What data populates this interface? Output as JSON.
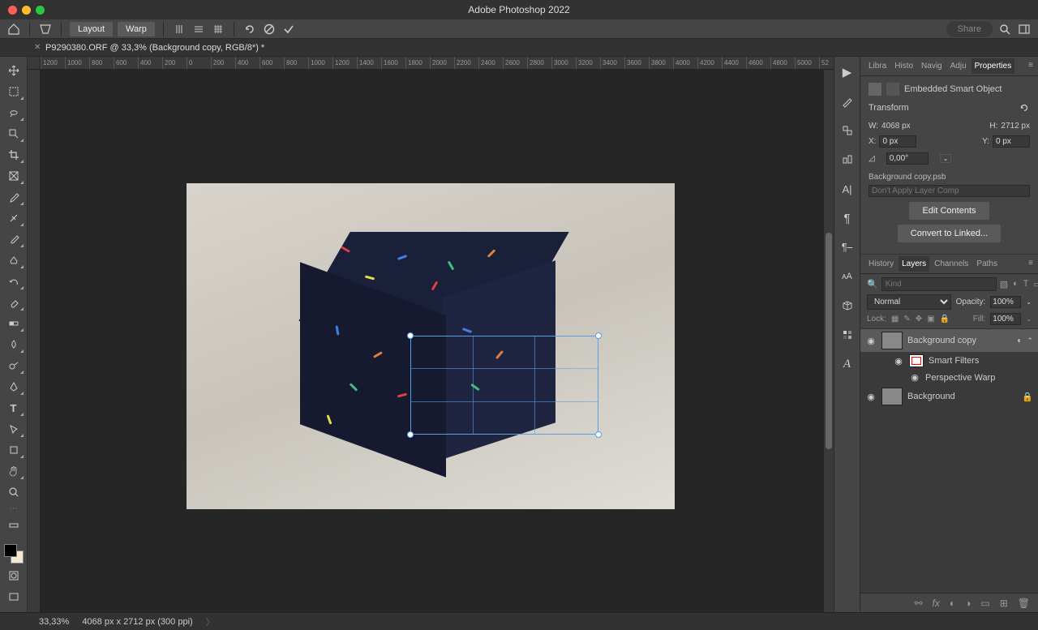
{
  "app": {
    "title": "Adobe Photoshop 2022"
  },
  "menubar": {
    "layout": "Layout",
    "warp": "Warp",
    "share": "Share"
  },
  "document": {
    "tab_title": "P9290380.ORF @ 33,3% (Background copy, RGB/8*) *"
  },
  "ruler_h": [
    "1200",
    "1000",
    "800",
    "600",
    "400",
    "200",
    "0",
    "200",
    "400",
    "600",
    "800",
    "1000",
    "1200",
    "1400",
    "1600",
    "1800",
    "2000",
    "2200",
    "2400",
    "2600",
    "2800",
    "3000",
    "3200",
    "3400",
    "3600",
    "3800",
    "4000",
    "4200",
    "4400",
    "4600",
    "4800",
    "5000",
    "52"
  ],
  "panel_tabs_top": {
    "t1": "Libra",
    "t2": "Histo",
    "t3": "Navig",
    "t4": "Adju",
    "t5": "Properties"
  },
  "properties": {
    "smart_object_label": "Embedded Smart Object",
    "transform_label": "Transform",
    "w_label": "W:",
    "w_value": "4068 px",
    "h_label": "H:",
    "h_value": "2712 px",
    "x_label": "X:",
    "x_value": "0 px",
    "y_label": "Y:",
    "y_value": "0 px",
    "angle_value": "0,00°",
    "psb_name": "Background copy.psb",
    "layer_comp": "Don't Apply Layer Comp",
    "edit_contents": "Edit Contents",
    "convert_linked": "Convert to Linked..."
  },
  "panel_tabs_bottom": {
    "t1": "History",
    "t2": "Layers",
    "t3": "Channels",
    "t4": "Paths"
  },
  "layers": {
    "filter_placeholder": "Kind",
    "blend_mode": "Normal",
    "opacity_label": "Opacity:",
    "opacity_value": "100%",
    "lock_label": "Lock:",
    "fill_label": "Fill:",
    "fill_value": "100%",
    "items": [
      {
        "name": "Background copy"
      },
      {
        "name": "Smart Filters"
      },
      {
        "name": "Perspective Warp"
      },
      {
        "name": "Background"
      }
    ]
  },
  "statusbar": {
    "zoom": "33,33%",
    "info": "4068 px x 2712 px (300 ppi)"
  }
}
